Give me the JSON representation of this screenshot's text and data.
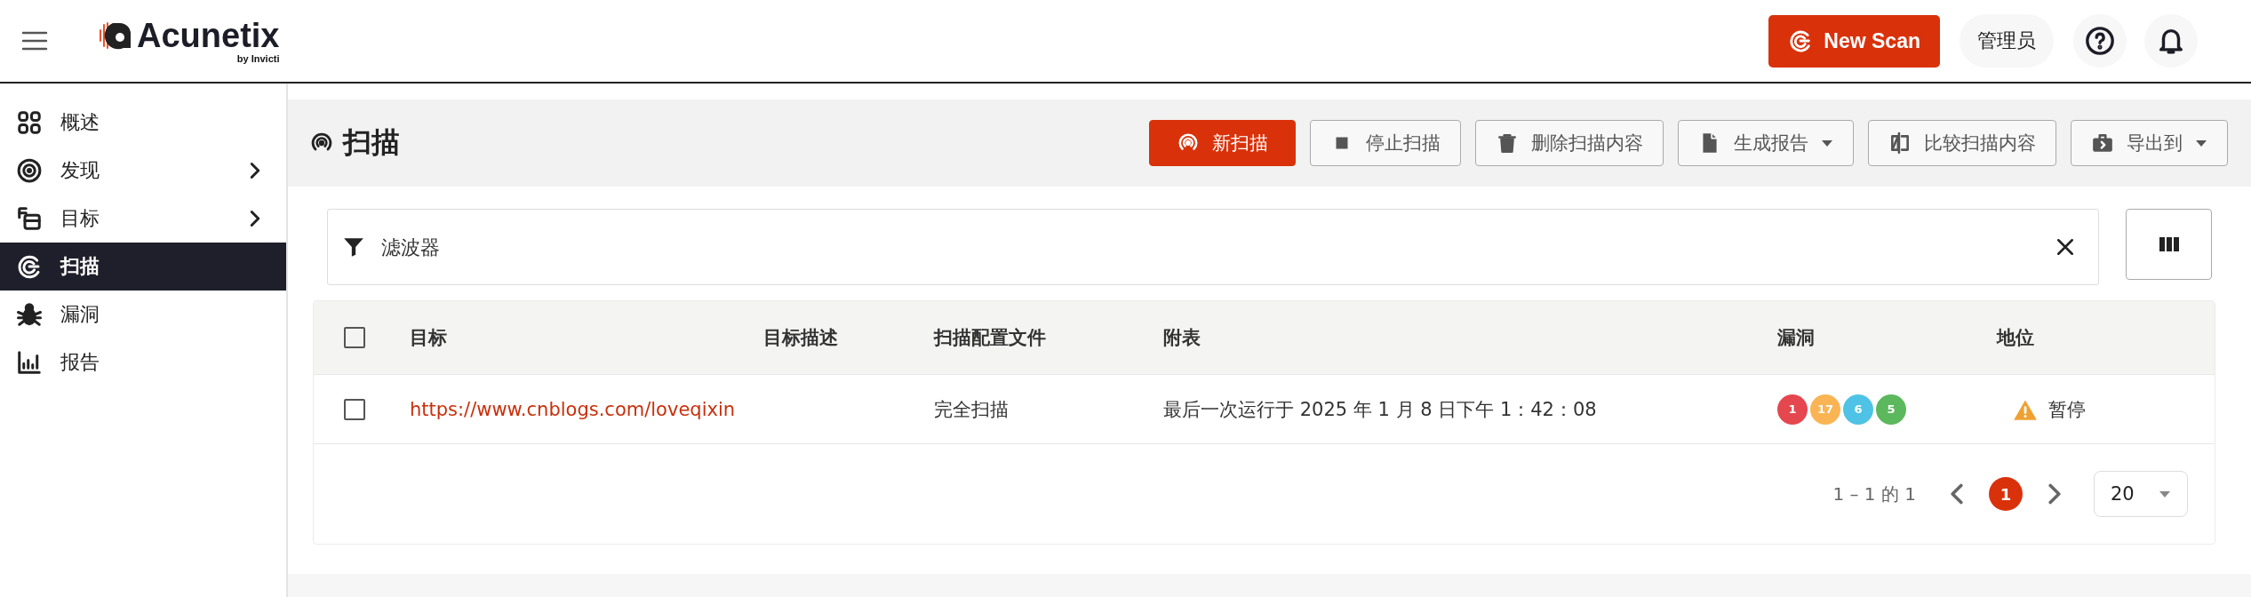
{
  "header": {
    "logo": {
      "name": "Acunetix",
      "tagline": "by Invicti"
    },
    "new_scan_button": "New Scan",
    "user": "管理员"
  },
  "sidebar": {
    "items": [
      {
        "label": "概述",
        "selected": false,
        "has_submenu": false
      },
      {
        "label": "发现",
        "selected": false,
        "has_submenu": true
      },
      {
        "label": "目标",
        "selected": false,
        "has_submenu": true
      },
      {
        "label": "扫描",
        "selected": true,
        "has_submenu": false
      },
      {
        "label": "漏洞",
        "selected": false,
        "has_submenu": false
      },
      {
        "label": "报告",
        "selected": false,
        "has_submenu": false
      }
    ]
  },
  "page": {
    "title": "扫描",
    "toolbar": [
      {
        "label": "新扫描",
        "kind": "primary",
        "dropdown": false
      },
      {
        "label": "停止扫描",
        "kind": "default",
        "dropdown": false
      },
      {
        "label": "删除扫描内容",
        "kind": "default",
        "dropdown": false
      },
      {
        "label": "生成报告",
        "kind": "default",
        "dropdown": true
      },
      {
        "label": "比较扫描内容",
        "kind": "default",
        "dropdown": false
      },
      {
        "label": "导出到",
        "kind": "default",
        "dropdown": true
      }
    ]
  },
  "filter": {
    "placeholder": "滤波器"
  },
  "table": {
    "select_all_checked": false,
    "columns": [
      "目标",
      "目标描述",
      "扫描配置文件",
      "附表",
      "漏洞",
      "地位"
    ],
    "rows": [
      {
        "checked": false,
        "target": "https://www.cnblogs.com/loveqixin",
        "profile": "完全扫描",
        "schedule": "最后一次运行于 2025 年 1 月 8 日下午 1：42：08",
        "vulnerabilities": [
          {
            "count": "1",
            "color": "#e5474f"
          },
          {
            "count": "17",
            "color": "#fbb454"
          },
          {
            "count": "6",
            "color": "#4ec3e6"
          },
          {
            "count": "5",
            "color": "#5cb85c"
          }
        ],
        "status": {
          "kind": "warning",
          "label": "暂停"
        }
      }
    ]
  },
  "pagination": {
    "summary": "1 – 1 的 1",
    "pages": [
      {
        "label": "1",
        "selected": true
      }
    ],
    "page_size": "20"
  }
}
